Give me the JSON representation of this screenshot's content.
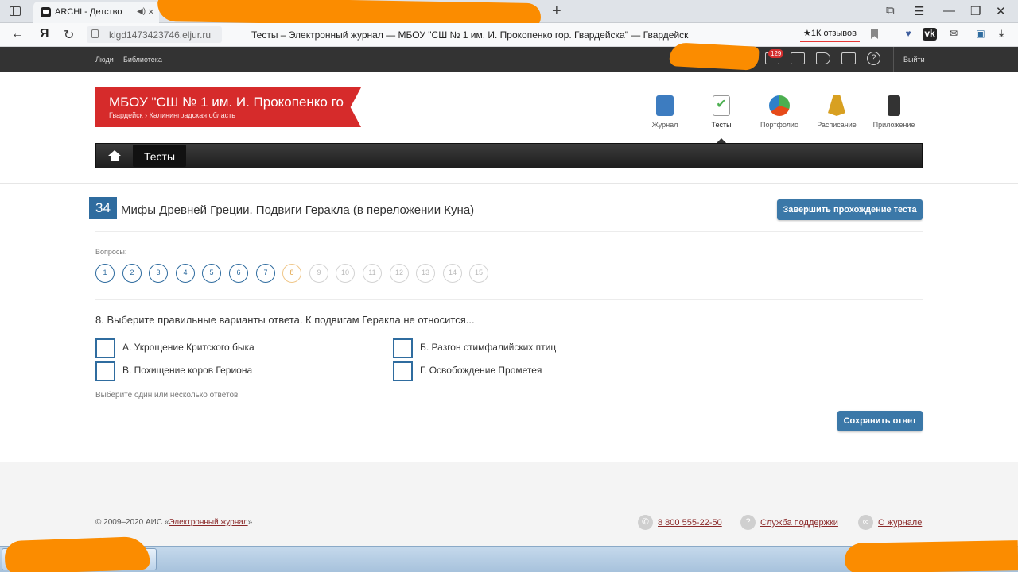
{
  "browser": {
    "tab_title": "ARCHI - Детство",
    "url": "klgd1473423746.eljur.ru",
    "page_title": "Тесты  – Электронный журнал — МБОУ \"СШ № 1 им. И. Прокопенко гор. Гвардейска\"  — Гвардейск",
    "reviews_label": "★1К отзывов",
    "new_tab": "+",
    "yandex": "Я"
  },
  "topbar": {
    "links": [
      "Люди",
      "Библиотека"
    ],
    "mail_count": "129",
    "logout": "Выйти",
    "help": "?"
  },
  "school": {
    "name": "МБОУ \"СШ № 1 им. И. Прокопенко гор. Гвардейска\"",
    "region": "Гвардейск › Калининградская область"
  },
  "modules": [
    {
      "label": "Журнал",
      "color": "#3d7cc0"
    },
    {
      "label": "Тесты",
      "color": "#4caf50"
    },
    {
      "label": "Портфолио",
      "color": "#e64a19"
    },
    {
      "label": "Расписание",
      "color": "#d8a021"
    },
    {
      "label": "Приложение",
      "color": "#333333"
    }
  ],
  "menu": {
    "active_item": "Тесты"
  },
  "test": {
    "number": "34",
    "title": "Мифы Древней Греции. Подвиги Геракла (в переложении Куна)",
    "finish_button": "Завершить прохождение теста",
    "questions_label": "Вопросы:",
    "questions": [
      "1",
      "2",
      "3",
      "4",
      "5",
      "6",
      "7",
      "8",
      "9",
      "10",
      "11",
      "12",
      "13",
      "14",
      "15"
    ],
    "answered_through": 7,
    "current": 8,
    "question_text": "8. Выберите правильные варианты ответа. К подвигам Геракла не относится...",
    "options": [
      "А. Укрощение Критского быка",
      "Б. Разгон стимфалийских птиц",
      "В. Похищение коров Гериона",
      "Г. Освобождение Прометея"
    ],
    "hint": "Выберите один или несколько ответов",
    "save_button": "Сохранить ответ"
  },
  "footer": {
    "copy_prefix": "© 2009–2020 АИС «",
    "copy_link": "Электронный журнал",
    "copy_suffix": "»",
    "phone": "8 800 555-22-50",
    "support": "Служба поддержки",
    "about": "О журнале"
  },
  "colors": {
    "accent": "#2f6c9f",
    "brand_red": "#d62b2b",
    "redaction": "#fb8c00"
  }
}
